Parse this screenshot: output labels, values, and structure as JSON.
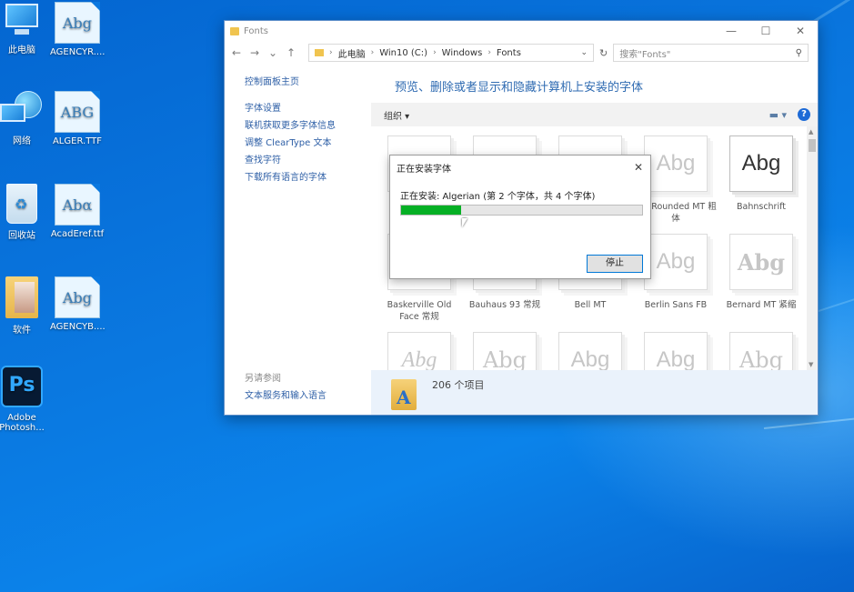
{
  "desktop": {
    "icons": [
      {
        "label": "此电脑",
        "icon": "computer-icon"
      },
      {
        "label": "AGENCYR....",
        "icon": "font-file-icon",
        "glyph": "Abg"
      },
      {
        "label": "网络",
        "icon": "network-icon"
      },
      {
        "label": "ALGER.TTF",
        "icon": "font-file-icon",
        "glyph": "ABG"
      },
      {
        "label": "回收站",
        "icon": "recycle-bin-icon"
      },
      {
        "label": "AcadEref.ttf",
        "icon": "font-file-icon",
        "glyph": "Abα"
      },
      {
        "label": "软件",
        "icon": "folder-icon"
      },
      {
        "label": "AGENCYB....",
        "icon": "font-file-icon",
        "glyph": "Abg"
      },
      {
        "label": "Adobe Photosh...",
        "icon": "photoshop-icon",
        "glyph": "Ps"
      }
    ]
  },
  "window": {
    "title": "Fonts",
    "controls": {
      "minimize": "—",
      "maximize": "☐",
      "close": "✕"
    },
    "nav": {
      "back": "←",
      "forward": "→",
      "recent": "⌄",
      "up": "↑"
    },
    "address": {
      "parts": [
        "此电脑",
        "Win10 (C:)",
        "Windows",
        "Fonts"
      ],
      "sep": "›"
    },
    "search_placeholder": "搜索\"Fonts\"",
    "sidebar": {
      "links": [
        "控制面板主页",
        "字体设置",
        "联机获取更多字体信息",
        "调整 ClearType 文本",
        "查找字符",
        "下载所有语言的字体"
      ],
      "see_also_heading": "另请参阅",
      "see_also_links": [
        "文本服务和输入语言"
      ]
    },
    "heading": "预览、删除或者显示和隐藏计算机上安装的字体",
    "toolbar": {
      "organize": "组织 ▾",
      "help": "?"
    },
    "fonts_row1": [
      {
        "name": "",
        "glyph": ""
      },
      {
        "name": "",
        "glyph": ""
      },
      {
        "name": "",
        "glyph": ""
      },
      {
        "name": "rial Rounded MT 粗体",
        "glyph": "Abg"
      },
      {
        "name": "Bahnschrift",
        "glyph": "Abg"
      }
    ],
    "fonts_row2": [
      {
        "name": "Baskerville Old Face 常规",
        "glyph": ""
      },
      {
        "name": "Bauhaus 93 常规",
        "glyph": ""
      },
      {
        "name": "Bell MT",
        "glyph": ""
      },
      {
        "name": "Berlin Sans FB",
        "glyph": "Abg"
      },
      {
        "name": "Bernard MT 紧缩",
        "glyph": "Abg"
      }
    ],
    "fonts_row3": [
      {
        "name": "",
        "glyph": "Abg"
      },
      {
        "name": "",
        "glyph": "Abg"
      },
      {
        "name": "",
        "glyph": "Abg"
      },
      {
        "name": "",
        "glyph": "Abg"
      },
      {
        "name": "",
        "glyph": "Abg"
      }
    ],
    "status": {
      "count": "206 个项目"
    }
  },
  "dialog": {
    "title": "正在安装字体",
    "close": "✕",
    "message": "正在安装: Algerian (第 2 个字体，共 4 个字体)",
    "progress": 0.25,
    "progress_color": "#06b025",
    "stop_button": "停止"
  }
}
